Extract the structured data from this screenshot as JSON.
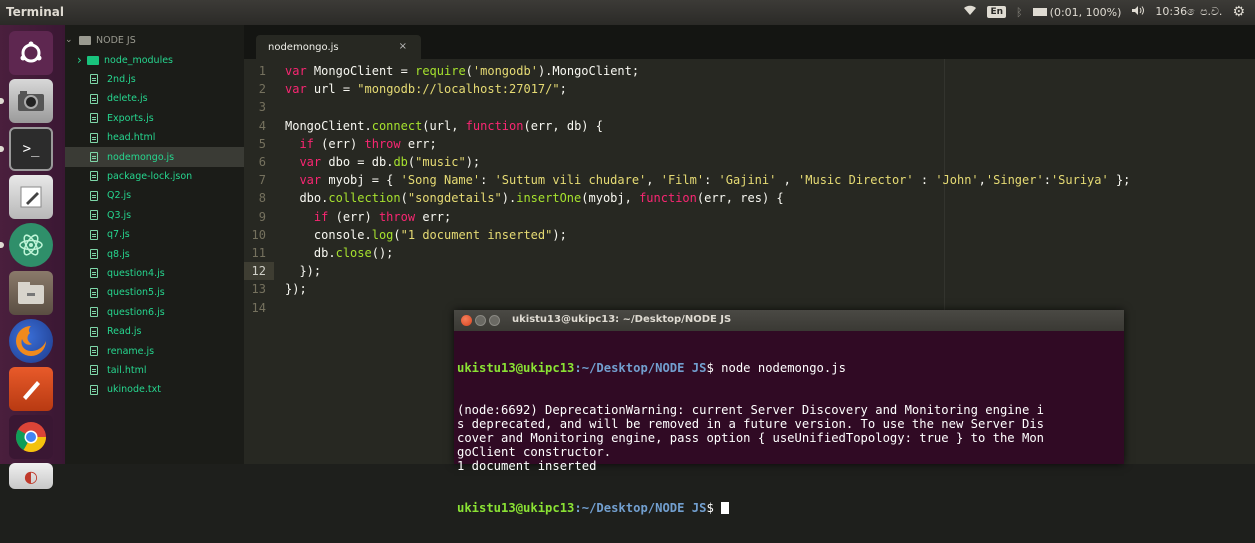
{
  "topbar": {
    "app_title": "Terminal",
    "keyboard_layout": "En",
    "battery_text": "(0:01, 100%)",
    "clock": "10:36 ෙප.ව."
  },
  "sidebar": {
    "root_folder": "NODE JS",
    "items": [
      {
        "label": "node_modules",
        "type": "folder"
      },
      {
        "label": "2nd.js",
        "type": "file"
      },
      {
        "label": "delete.js",
        "type": "file"
      },
      {
        "label": "Exports.js",
        "type": "file"
      },
      {
        "label": "head.html",
        "type": "file"
      },
      {
        "label": "nodemongo.js",
        "type": "file",
        "selected": true
      },
      {
        "label": "package-lock.json",
        "type": "file"
      },
      {
        "label": "Q2.js",
        "type": "file"
      },
      {
        "label": "Q3.js",
        "type": "file"
      },
      {
        "label": "q7.js",
        "type": "file"
      },
      {
        "label": "q8.js",
        "type": "file"
      },
      {
        "label": "question4.js",
        "type": "file"
      },
      {
        "label": "question5.js",
        "type": "file"
      },
      {
        "label": "question6.js",
        "type": "file"
      },
      {
        "label": "Read.js",
        "type": "file"
      },
      {
        "label": "rename.js",
        "type": "file"
      },
      {
        "label": "tail.html",
        "type": "file"
      },
      {
        "label": "ukinode.txt",
        "type": "file"
      }
    ]
  },
  "editor": {
    "tab_title": "nodemongo.js",
    "tab_close": "×",
    "active_line": 12,
    "line_numbers": [
      "1",
      "2",
      "3",
      "4",
      "5",
      "6",
      "7",
      "8",
      "9",
      "10",
      "11",
      "12",
      "13",
      "14"
    ],
    "code_lines": [
      "var MongoClient = require('mongodb').MongoClient;",
      "var url = \"mongodb://localhost:27017/\";",
      "",
      "MongoClient.connect(url, function(err, db) {",
      "  if (err) throw err;",
      "  var dbo = db.db(\"music\");",
      "  var myobj = { 'Song Name': 'Suttum vili chudare', 'Film': 'Gajini' , 'Music Director' : 'John','Singer':'Suriya' };",
      "  dbo.collection(\"songdetails\").insertOne(myobj, function(err, res) {",
      "    if (err) throw err;",
      "    console.log(\"1 document inserted\");",
      "    db.close();",
      "  });",
      "});",
      ""
    ]
  },
  "terminal": {
    "window_title": "ukistu13@ukipc13: ~/Desktop/NODE JS",
    "prompt_user": "ukistu13@ukipc13",
    "prompt_path": ":~/Desktop/NODE JS",
    "prompt_symbol": "$",
    "command": " node nodemongo.js",
    "output_lines": [
      "(node:6692) DeprecationWarning: current Server Discovery and Monitoring engine i",
      "s deprecated, and will be removed in a future version. To use the new Server Dis",
      "cover and Monitoring engine, pass option { useUnifiedTopology: true } to the Mon",
      "goClient constructor.",
      "1 document inserted"
    ]
  },
  "launcher": {
    "icons": [
      "ubuntu-dash-icon",
      "camera-icon",
      "terminal-icon",
      "text-editor-icon",
      "atom-icon",
      "files-icon",
      "firefox-icon",
      "text-editor-pen-icon",
      "chrome-icon",
      "app-icon"
    ]
  },
  "colors": {
    "launcher_bg": "#4a1f3d",
    "editor_bg": "#272822",
    "terminal_bg": "#300a24",
    "sidebar_file": "#26d68f",
    "prompt_green": "#8ae234",
    "prompt_blue": "#729fcf"
  }
}
